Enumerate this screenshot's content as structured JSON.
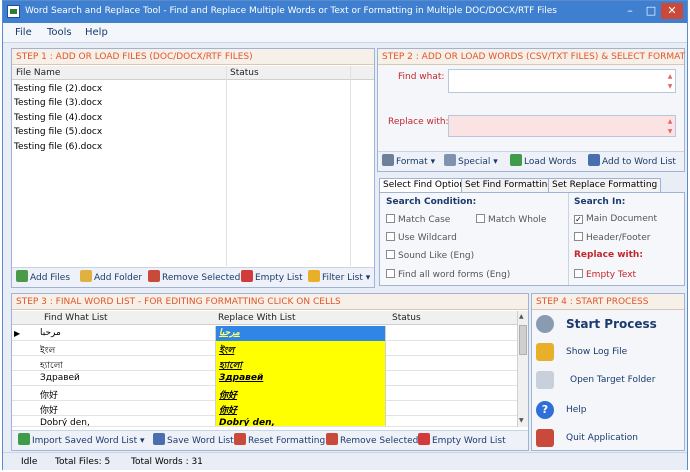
{
  "window": {
    "title": "Word Search and Replace Tool  -  Find and Replace Multiple Words or Text  or Formatting in Multiple DOC/DOCX/RTF Files"
  },
  "menu": [
    "File",
    "Tools",
    "Help"
  ],
  "step1": {
    "header": "STEP 1 : ADD OR LOAD FILES (DOC/DOCX/RTF FILES)",
    "columns": [
      "File Name",
      "Status"
    ],
    "files": [
      "Testing file (2).docx",
      "Testing file (3).docx",
      "Testing file (4).docx",
      "Testing file (5).docx",
      "Testing file (6).docx"
    ],
    "toolbar": {
      "add_files": "Add Files",
      "add_folder": "Add Folder",
      "remove_selected": "Remove Selected",
      "empty_list": "Empty List",
      "filter_list": "Filter List"
    }
  },
  "step2": {
    "header": "STEP 2 : ADD OR LOAD WORDS (CSV/TXT FILES) & SELECT FORMAT",
    "find_label": "Find what:",
    "replace_label": "Replace with:",
    "find_value": "",
    "replace_value": "",
    "toolbar": {
      "format": "Format",
      "special": "Special",
      "load_words": "Load Words",
      "add_to_word_list": "Add to Word List"
    }
  },
  "options": {
    "tabs": [
      "Select Find Options",
      "Set Find Formatting",
      "Set Replace Formatting"
    ],
    "search_condition": "Search Condition:",
    "search_in": "Search In:",
    "replace_with": "Replace with:",
    "match_case": "Match Case",
    "match_whole": "Match Whole",
    "use_wildcard": "Use Wildcard",
    "sound_like": "Sound Like (Eng)",
    "all_word_forms": "Find all word forms (Eng)",
    "main_document": "Main Document",
    "header_footer": "Header/Footer",
    "empty_text": "Empty Text",
    "main_document_checked": true
  },
  "step3": {
    "header": "STEP 3 : FINAL WORD LIST - FOR EDITING FORMATTING CLICK ON CELLS",
    "columns": [
      "Find What List",
      "Replace With List",
      "Status"
    ],
    "rows": [
      {
        "find": "مرحبا",
        "replace": "مرحبا"
      },
      {
        "find": "ইংল",
        "replace": "ইংল"
      },
      {
        "find": "হ্যালো",
        "replace": "হ্যালো"
      },
      {
        "find": "Здравей",
        "replace": "Здравей"
      },
      {
        "find": "你好",
        "replace": "你好"
      },
      {
        "find": "你好",
        "replace": "你好"
      },
      {
        "find": "Dobrý den,",
        "replace": "Dobrý den,"
      }
    ],
    "toolbar": {
      "import": "Import Saved Word List",
      "save": "Save Word List",
      "reset": "Reset Formatting",
      "remove": "Remove Selected",
      "empty": "Empty Word List"
    }
  },
  "step4": {
    "header": "STEP 4 : START PROCESS",
    "start": "Start Process",
    "show_log": "Show Log File",
    "open_target": "Open Target Folder",
    "help": "Help",
    "quit": "Quit Application"
  },
  "status": {
    "state": "Idle",
    "total_files": "Total Files: 5",
    "total_words": "Total Words : 31"
  }
}
